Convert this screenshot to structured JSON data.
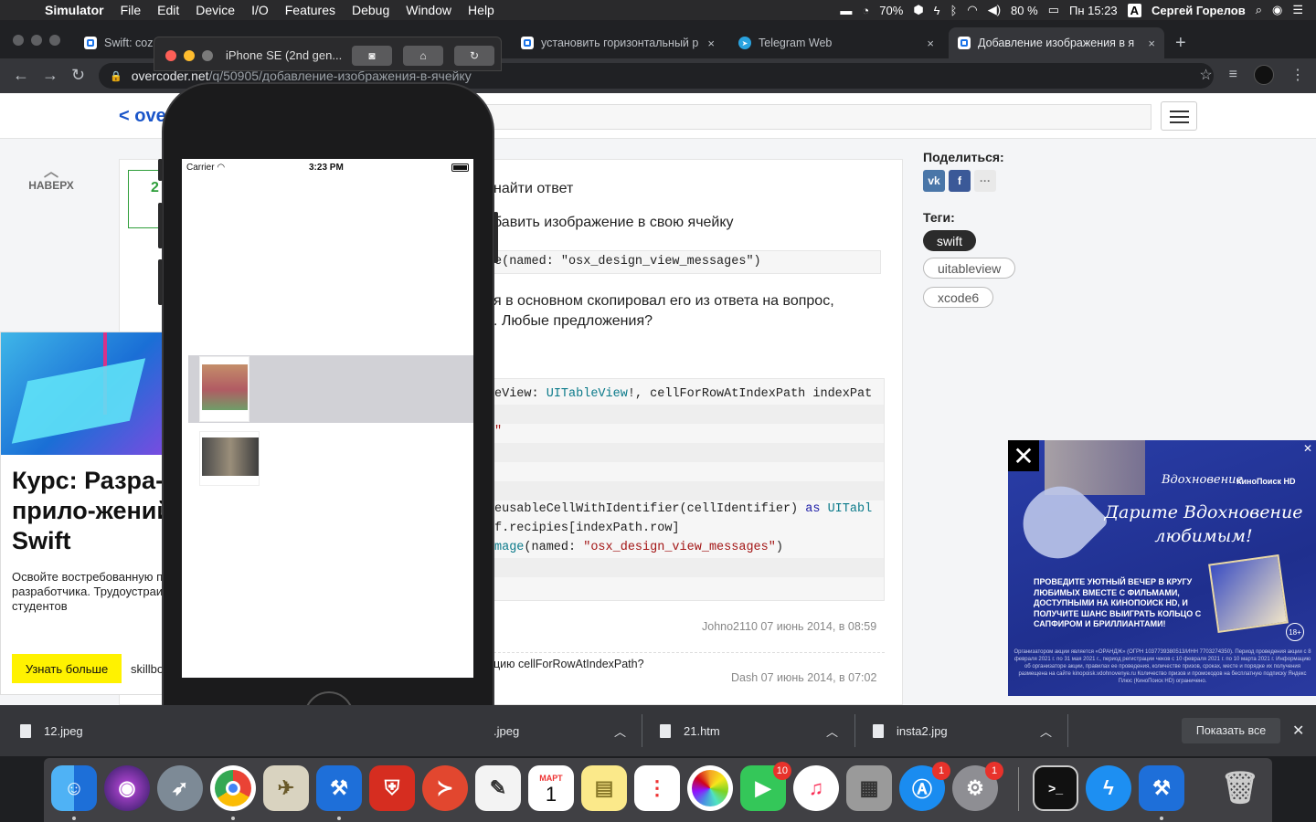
{
  "menubar": {
    "app": "Simulator",
    "items": [
      "File",
      "Edit",
      "Device",
      "I/O",
      "Features",
      "Debug",
      "Window",
      "Help"
    ],
    "cpu": "70%",
    "battery": "80 %",
    "clock": "Пн 15:23",
    "input": "A",
    "user": "Сергей Горелов"
  },
  "tabs": [
    {
      "title": "Swift: cozd",
      "close": "×"
    },
    {
      "title": "установить горизонтальный р",
      "close": "×"
    },
    {
      "title": "Telegram Web",
      "close": "×"
    },
    {
      "title": "Добавление изображения в я",
      "close": "×"
    }
  ],
  "address": {
    "host": "overcoder.net",
    "path": "/q/50905/добавление-изображения-в-ячейку"
  },
  "site": {
    "logo": "< ove",
    "up_label": "НАВЕРХ",
    "vote": "2"
  },
  "question": {
    "line1": "найти ответ",
    "line2": "бавить изображение в свою ячейку",
    "line3": "я в основном скопировал его из ответа на вопрос,",
    "line4": ". Любые предложения?"
  },
  "code1": "e(named: \"osx_design_view_messages\")",
  "code2": {
    "l1a": "eView: ",
    "l1b": "UITableView",
    "l1c": "!, cellForRowAtIndexPath indexPat",
    "l2": "\"",
    "l3": "",
    "l4": "",
    "l5a": "eusableCellWithIdentifier(cellIdentifier) ",
    "l5b": "as",
    "l5c": " UITabl",
    "l6": "f.recipies[indexPath.row]",
    "l7a": "mage",
    "l7b": "(named: ",
    "l7c": "\"osx_design_view_messages\"",
    "l7d": ")"
  },
  "author1": "Johno2110 07 июнь 2014, в 08:59",
  "comment": "цию cellForRowAtIndexPath?",
  "author2": "Dash 07 июнь 2014, в 07:02",
  "sidebar": {
    "share": "Поделиться:",
    "vk": "vk",
    "fb": "f",
    "more": "···",
    "tags_title": "Теги:",
    "tags": [
      "swift",
      "uitableview",
      "xcode6"
    ]
  },
  "left_ad": {
    "headline": "Курс: Разра-ботка прило-жений на Swift",
    "text": "Освойте востребованную профессию iOS-разработчика. Трудоустраиваем 88% студентов",
    "button": "Узнать больше",
    "brand": "skillbox"
  },
  "right_ad": {
    "close": "✕",
    "small_close": "✕",
    "logo1": "Вдохновение",
    "logo2": "КиноПоиск HD",
    "slogan": "Дарите Вдохновение любимым!",
    "body": "Проведите уютный вечер в кругу любимых вместе с фильмами, доступными на КиноПоиск HD, и получите шанс выиграть кольцо с сапфиром и бриллиантами!",
    "age": "18+",
    "fine": "Организатором акции является «ОРАНДЖ» (ОГРН 1037739380513/ИНН 7703274350). Период проведения акции с 8 февраля 2021 г. по 31 мая 2021 г., период регистрации чеков с 10 февраля 2021 г. по 10 марта 2021 г. Информацию об организаторе акции, правилах ее проведения, количестве призов, сроках, месте и порядке их получения размещена на сайте kinopoisk.vdohnovenye.ru Количество призов и промокодов на бесплатную подписку Яндекс Плюс (КиноПоиск HD) ограничено."
  },
  "simulator": {
    "title": "iPhone SE (2nd gen...",
    "carrier": "Carrier",
    "time": "3:23 PM"
  },
  "downloads": {
    "items": [
      "12.jpeg",
      ".jpeg",
      "21.htm",
      "insta2.jpg"
    ],
    "show_all": "Показать все",
    "close": "✕"
  },
  "dock": {
    "facetime_badge": "10",
    "appstore_badge": "1",
    "prefs_badge": "1",
    "calendar_month": "МАРТ",
    "calendar_day": "1"
  }
}
